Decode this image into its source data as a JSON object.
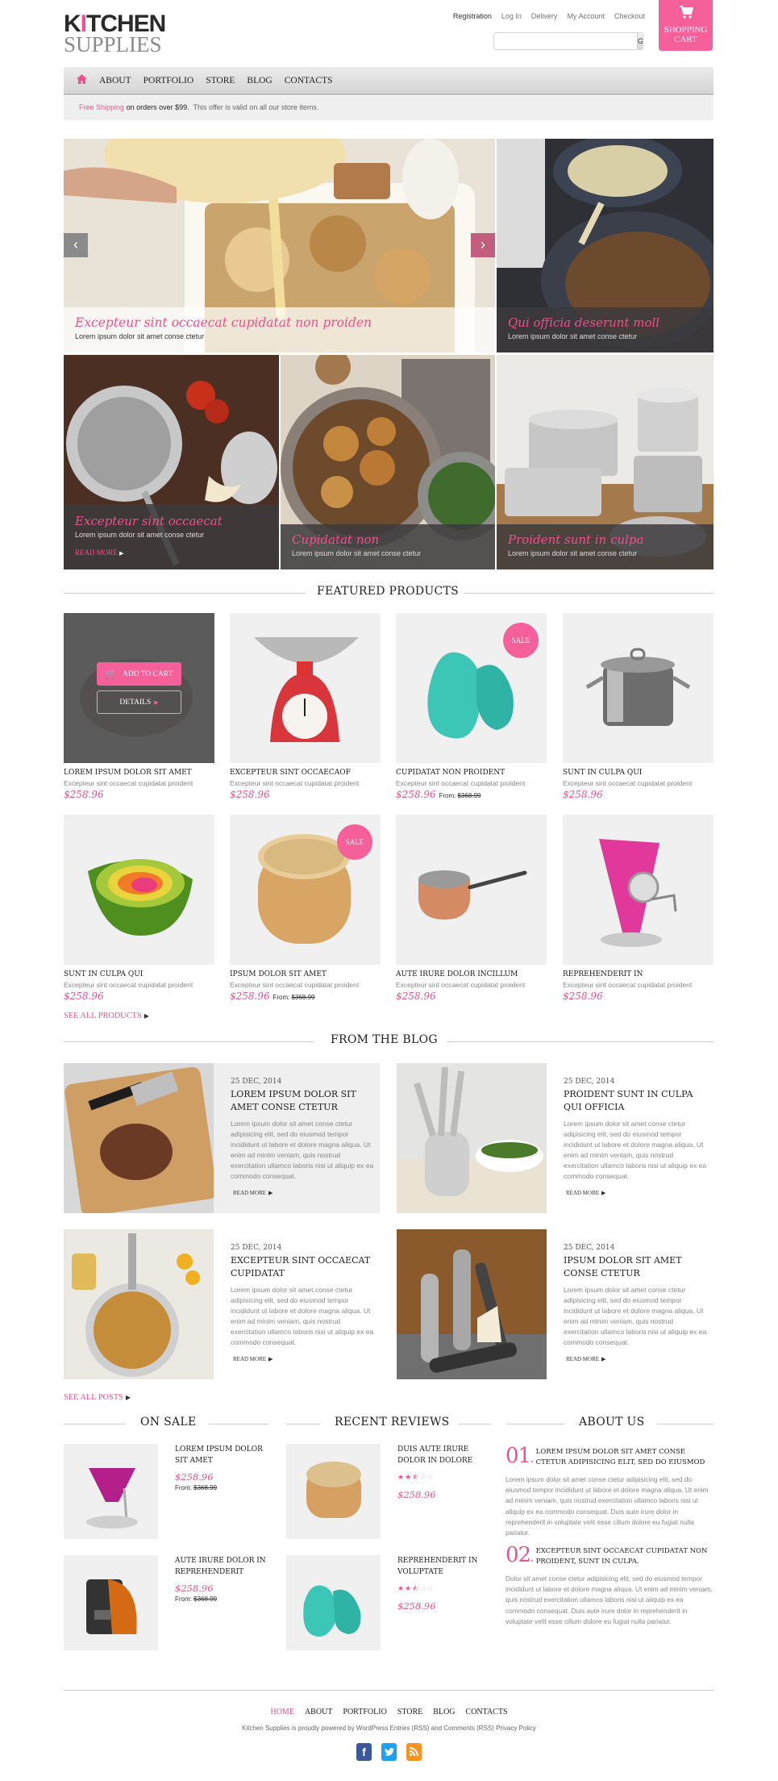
{
  "brand": {
    "line1_pre": "K",
    "line1_accent": "I",
    "line1_post": "TCHEN",
    "line2": "SUPPLIES",
    "accent": "#f24f8e"
  },
  "top_links": [
    "Registration",
    "Log In",
    "Delivery",
    "My Account",
    "Checkout"
  ],
  "search": {
    "value": "",
    "placeholder": "",
    "button": "Go"
  },
  "cart": {
    "icon": "cart-icon",
    "label_line1": "SHOPPING",
    "label_line2": "CART"
  },
  "nav": {
    "home_icon": "home-icon",
    "items": [
      "ABOUT",
      "PORTFOLIO",
      "STORE",
      "BLOG",
      "CONTACTS"
    ]
  },
  "promo": {
    "highlight": "Free Shipping",
    "bold": "on orders over $99.",
    "rest": "This offer is valid on all our store items."
  },
  "slider": {
    "prev_icon": "chevron-left-icon",
    "next_icon": "chevron-right-icon",
    "tiles": [
      {
        "title": "Excepteur sint occaecat cupidatat non proiden",
        "text": "Lorem ipsum dolor sit amet conse ctetur"
      },
      {
        "title": "Qui officia deserunt moll",
        "text": "Lorem ipsum dolor sit amet conse ctetur"
      },
      {
        "title": "Excepteur sint occaecat",
        "text": "Lorem ipsum dolor sit amet conse ctetur",
        "more": "READ MORE"
      },
      {
        "title": "Cupidatat non",
        "text": "Lorem ipsum dolor sit amet conse ctetur"
      },
      {
        "title": "Proident sunt in culpa",
        "text": "Lorem ipsum dolor sit amet conse ctetur"
      }
    ]
  },
  "featured": {
    "title": "FEATURED PRODUCTS",
    "add_to_cart": "ADD TO CART",
    "details": "DETAILS",
    "sale_badge": "SALE",
    "from_label": "From:",
    "products": [
      {
        "name": "LOREM IPSUM DOLOR SIT AMET",
        "desc": "Excepteur sint occaecat cupidatat  proident",
        "price": "$258.96",
        "hover": true
      },
      {
        "name": "EXCEPTEUR SINT OCCAECAOF",
        "desc": "Excepteur sint occaecat cupidatat  proident",
        "price": "$258.96"
      },
      {
        "name": "CUPIDATAT NON PROIDENT",
        "desc": "Excepteur sint occaecat cupidatat  proident",
        "price": "$258.96",
        "old_price": "$368.99",
        "sale": true
      },
      {
        "name": "SUNT IN CULPA QUI",
        "desc": "Excepteur sint occaecat cupidatat  proident",
        "price": "$258.96"
      },
      {
        "name": " SUNT IN CULPA QUI",
        "desc": "Excepteur sint occaecat cupidatat  proident",
        "price": "$258.96"
      },
      {
        "name": "IPSUM DOLOR SIT AMET",
        "desc": "Excepteur sint occaecat cupidatat  proident",
        "price": "$258.96",
        "old_price": "$368.99",
        "sale": true
      },
      {
        "name": "AUTE IRURE DOLOR INCILLUM",
        "desc": "Excepteur sint occaecat cupidatat  proident",
        "price": "$258.96"
      },
      {
        "name": " REPREHENDERIT IN",
        "desc": "Excepteur sint occaecat cupidatat  proident",
        "price": "$258.96"
      }
    ],
    "see_all": "SEE ALL PRODUCTS"
  },
  "blog": {
    "title": "FROM THE BLOG",
    "read_more": "READ MORE",
    "posts": [
      {
        "date": "25 DEC, 2014",
        "title": "LOREM IPSUM DOLOR SIT AMET CONSE CTETUR",
        "text": "Lorem ipsum dolor sit amet conse ctetur adipisicing elit, sed do eiusmod tempor incididunt ut labore et dolore magna aliqua. Ut enim ad minim veniam, quis nostrud exercitation ullamco laboris nisi ut aliquip ex ea commodo consequat."
      },
      {
        "date": "25 DEC, 2014",
        "title": "PROIDENT SUNT IN CULPA QUI OFFICIA",
        "text": "Lorem ipsum dolor sit amet conse ctetur adipisicing elit, sed do eiusmod tempor incididunt ut labore et dolore magna aliqua. Ut enim ad minim veniam, quis nostrud exercitation ullamco laboris nisi ut aliquip ex ea commodo consequat."
      },
      {
        "date": "25 DEC, 2014",
        "title": "EXCEPTEUR SINT OCCAECAT CUPIDATAT",
        "text": "Lorem ipsum dolor sit amet conse ctetur adipisicing elit, sed do eiusmod tempor incididunt ut labore et dolore magna aliqua. Ut enim ad minim veniam, quis nostrud exercitation ullamco laboris nisi ut aliquip ex ea commodo consequat."
      },
      {
        "date": "25 DEC, 2014",
        "title": "IPSUM DOLOR SIT AMET CONSE CTETUR",
        "text": "Lorem ipsum dolor sit amet conse ctetur adipisicing elit, sed do eiusmod tempor incididunt ut labore et dolore magna aliqua. Ut enim ad minim veniam, quis nostrud exercitation ullamco laboris nisi ut aliquip ex ea commodo consequat."
      }
    ],
    "see_all": "SEE ALL POSTS"
  },
  "on_sale": {
    "title": "ON SALE",
    "items": [
      {
        "name": "LOREM IPSUM DOLOR SIT AMET",
        "price": "$258.96",
        "from": "From:",
        "old_price": "$368.99"
      },
      {
        "name": "AUTE IRURE DOLOR IN REPREHENDERIT",
        "price": "$258.96",
        "from": "From:",
        "old_price": "$368.99"
      }
    ]
  },
  "reviews": {
    "title": "RECENT REVIEWS",
    "items": [
      {
        "name": "DUIS AUTE IRURE DOLOR IN DOLORE",
        "rating": 2.5,
        "max": 5,
        "price": "$258.96"
      },
      {
        "name": "REPREHENDERIT IN VOLUPTATE",
        "rating": 2.5,
        "max": 5,
        "price": "$258.96"
      }
    ]
  },
  "about": {
    "title": "ABOUT US",
    "items": [
      {
        "num": "01",
        "heading": "LOREM IPSUM DOLOR SIT AMET CONSE CTETUR ADIPISICING ELIT, SED DO EIUSMOD",
        "text": "Lorem ipsum dolor sit amet conse ctetur adipisicing elit, sed do eiusmod tempor incididunt ut labore et dolore magna aliqua. Ut enim ad minim veniam, quis nostrud exercitation ullamco laboris nisi ut aliquip ex ea commodo consequat. Duis aute irure dolor in reprehenderit in voluptate velit esse cillum dolore eu fugiat nulla pariatur."
      },
      {
        "num": "02",
        "heading": "EXCEPTEUR SINT OCCAECAT CUPIDATAT NON PROIDENT, SUNT IN CULPA.",
        "text": "Dolor sit amet conse ctetur adipisicing elit, sed do eiusmod tempor incididunt ut labore et dolore magna aliqua. Ut enim ad minim veniam, quis nostrud exercitation ullamco laboris nisi ut aliquip ex ea commodo consequat. Duis aute irure dolor in reprehenderit in voluptate velit esse cillum dolore eu fugiat nulla pariatur."
      }
    ]
  },
  "footer": {
    "nav": [
      "HOME",
      "ABOUT",
      "PORTFOLIO",
      "STORE",
      "BLOG",
      "CONTACTS"
    ],
    "active": "HOME",
    "text": "Kitchen Supplies is proudly powered by WordPress Entries (RSS) and Comments (RSS) Privacy Policy",
    "social": [
      {
        "icon": "facebook-icon",
        "color": "#3b5998"
      },
      {
        "icon": "twitter-icon",
        "color": "#1da1f2"
      },
      {
        "icon": "rss-icon",
        "color": "#f7931e"
      }
    ]
  },
  "colors": {
    "accent": "#f24f8e",
    "cart_bg": "#f5609a",
    "tile_bg": "#f0f0f0"
  }
}
